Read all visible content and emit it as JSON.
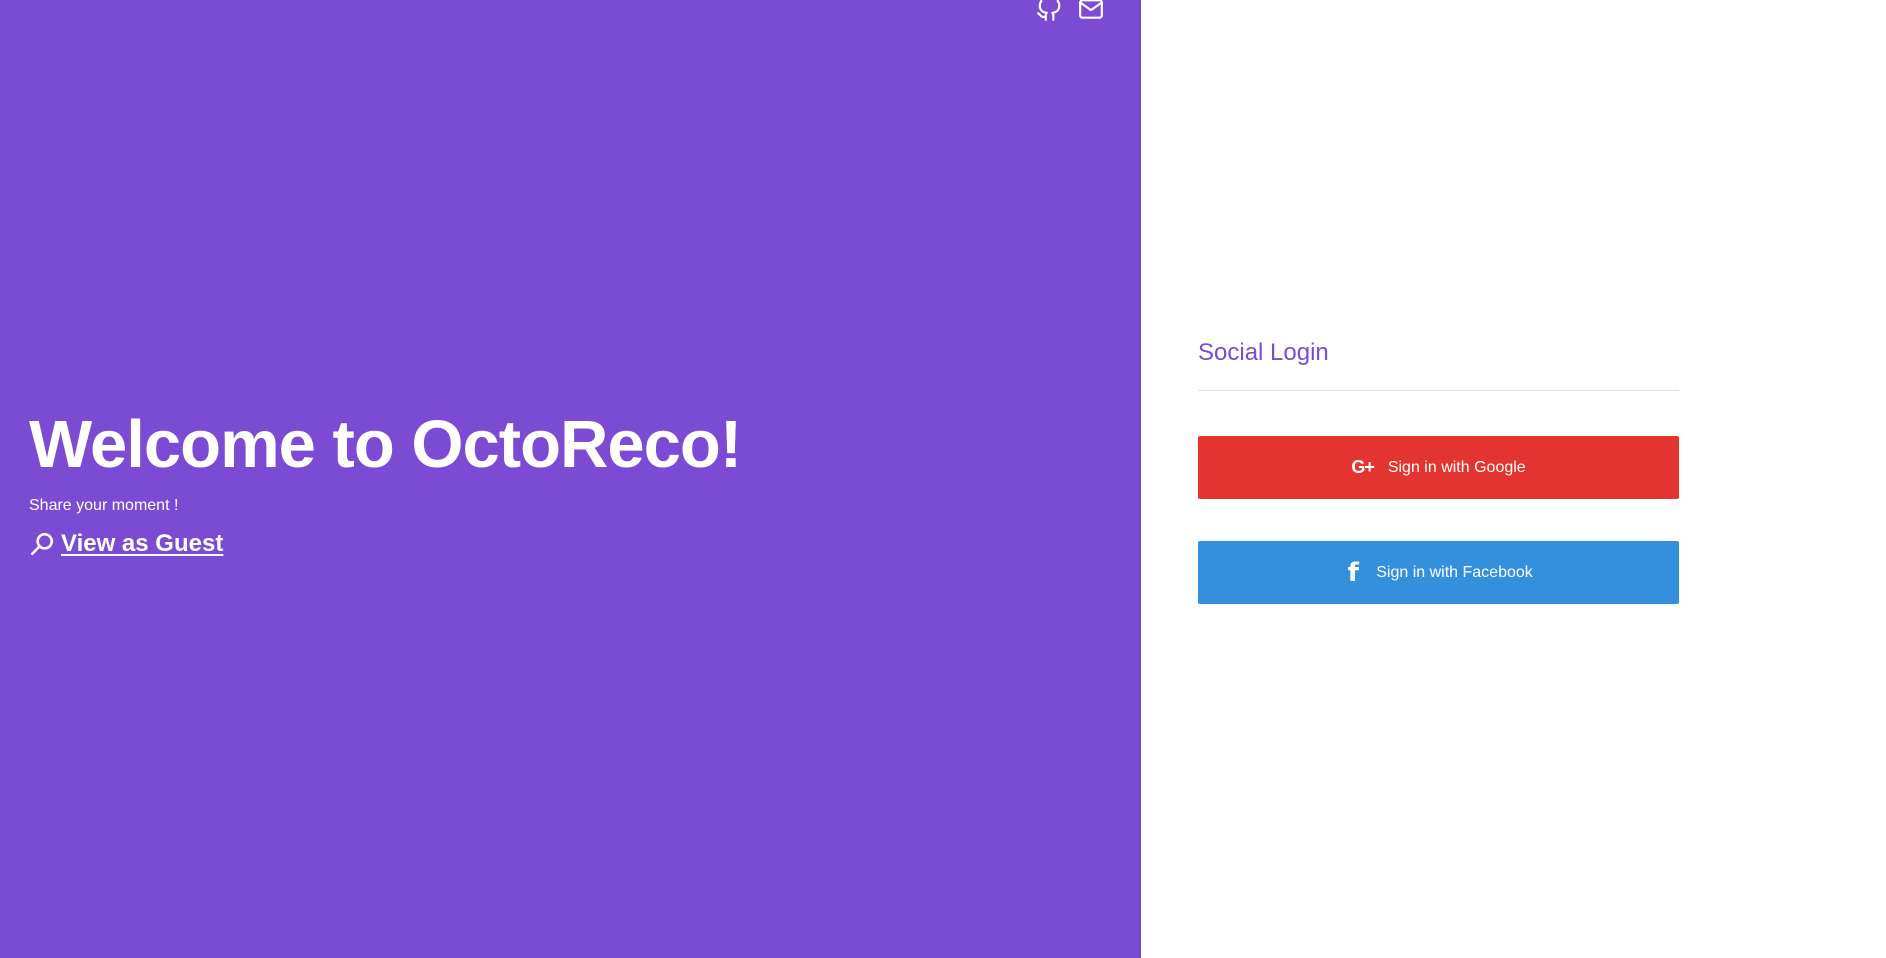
{
  "header": {
    "icons": [
      {
        "name": "github-icon"
      },
      {
        "name": "mail-icon"
      }
    ]
  },
  "hero": {
    "title": "Welcome to OctoReco!",
    "subtitle": "Share your moment !",
    "guest_link": "View as Guest",
    "guest_icon": "search-icon"
  },
  "login": {
    "heading": "Social Login",
    "google": {
      "label": "Sign in with Google",
      "icon": "G+",
      "color": "#e3342f"
    },
    "facebook": {
      "label": "Sign in with Facebook",
      "icon": "f",
      "color": "#3490dc"
    }
  },
  "colors": {
    "brand": "#7b4bd3",
    "background": "#ffffff",
    "divider": "#e2e2e2"
  }
}
